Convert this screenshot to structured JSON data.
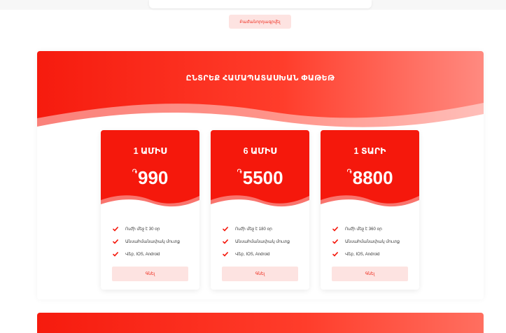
{
  "subscribe_button": {
    "label": "Բաժանորդագրվել"
  },
  "pricing": {
    "title": "ԸՆՏՐԵՔ ՀԱՄԱՊԱՏԱՍԽԱՆ ՓԱԹԵԹ",
    "currency_symbol": "֏",
    "accent_color": "#f5180c",
    "plans": [
      {
        "period": "1 ԱՄԻՍ",
        "price": "990",
        "features": [
          "Ուժի մեջ է 30 օր",
          "Անսահմանափակ մուտք",
          "Վեբ, IOS, Android"
        ],
        "button": "Գնել"
      },
      {
        "period": "6 ԱՄԻՍ",
        "price": "5500",
        "features": [
          "Ուժի մեջ է 180 օր",
          "Անսահմանափակ մուտք",
          "Վեբ, IOS, Android"
        ],
        "button": "Գնել"
      },
      {
        "period": "1 ՏԱՐԻ",
        "price": "8800",
        "features": [
          "Ուժի մեջ է 360 օր",
          "Անսահմանափակ մուտք",
          "Վեբ, IOS, Android"
        ],
        "button": "Գնել"
      }
    ]
  },
  "icons": {
    "feature": "check-icon"
  }
}
